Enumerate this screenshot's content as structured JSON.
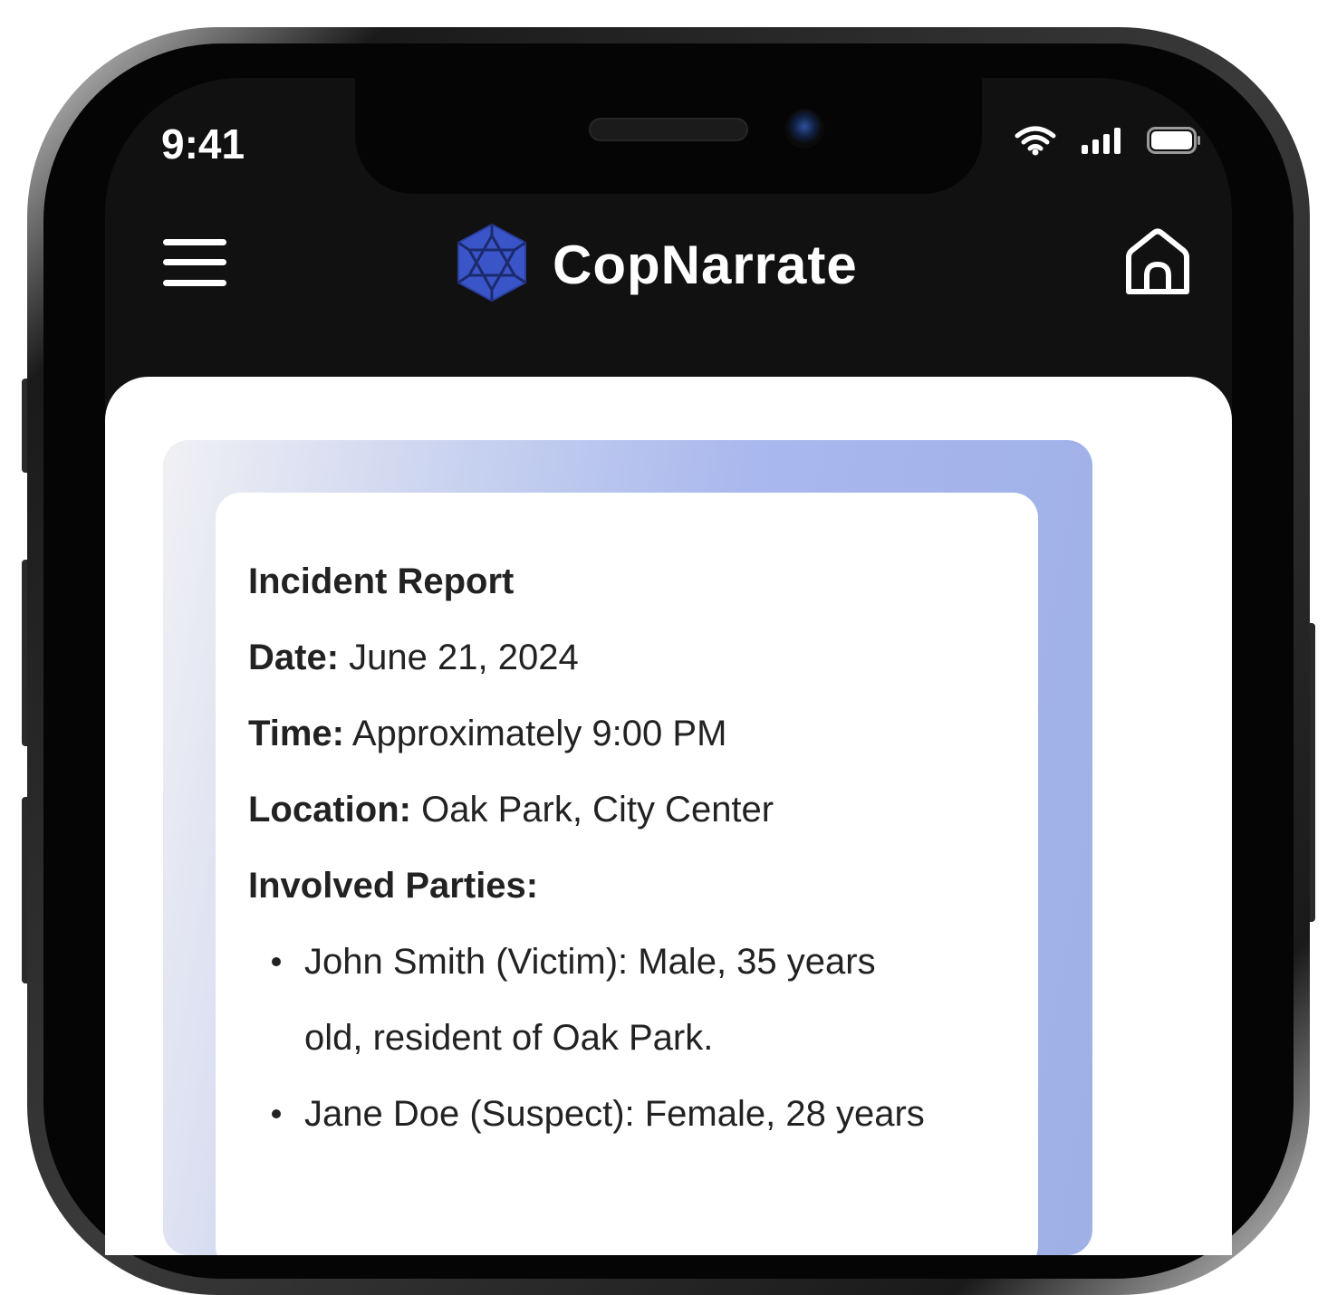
{
  "status_bar": {
    "time": "9:41",
    "icons": [
      "wifi-icon",
      "cellular-signal-icon",
      "battery-icon"
    ]
  },
  "app_bar": {
    "menu_icon": "hamburger-menu-icon",
    "logo_icon": "geodesic-sphere-logo",
    "title": "CopNarrate",
    "home_icon": "home-icon"
  },
  "colors": {
    "app_bar_background": "#111111",
    "logo_blue": "#3a55c8",
    "card_gradient_start": "#f1f1f4",
    "card_gradient_end": "#9eb0e6",
    "text": "#222222"
  },
  "report": {
    "title": "Incident Report",
    "date_label": "Date:",
    "date_value": "June 21, 2024",
    "time_label": "Time:",
    "time_value": "Approximately 9:00 PM",
    "location_label": "Location:",
    "location_value": "Oak Park, City Center",
    "parties_label": "Involved Parties:",
    "parties": [
      {
        "line1": "John Smith (Victim): Male, 35 years",
        "line2": "old, resident of Oak Park."
      },
      {
        "line1": "Jane Doe (Suspect): Female, 28 years"
      }
    ]
  }
}
